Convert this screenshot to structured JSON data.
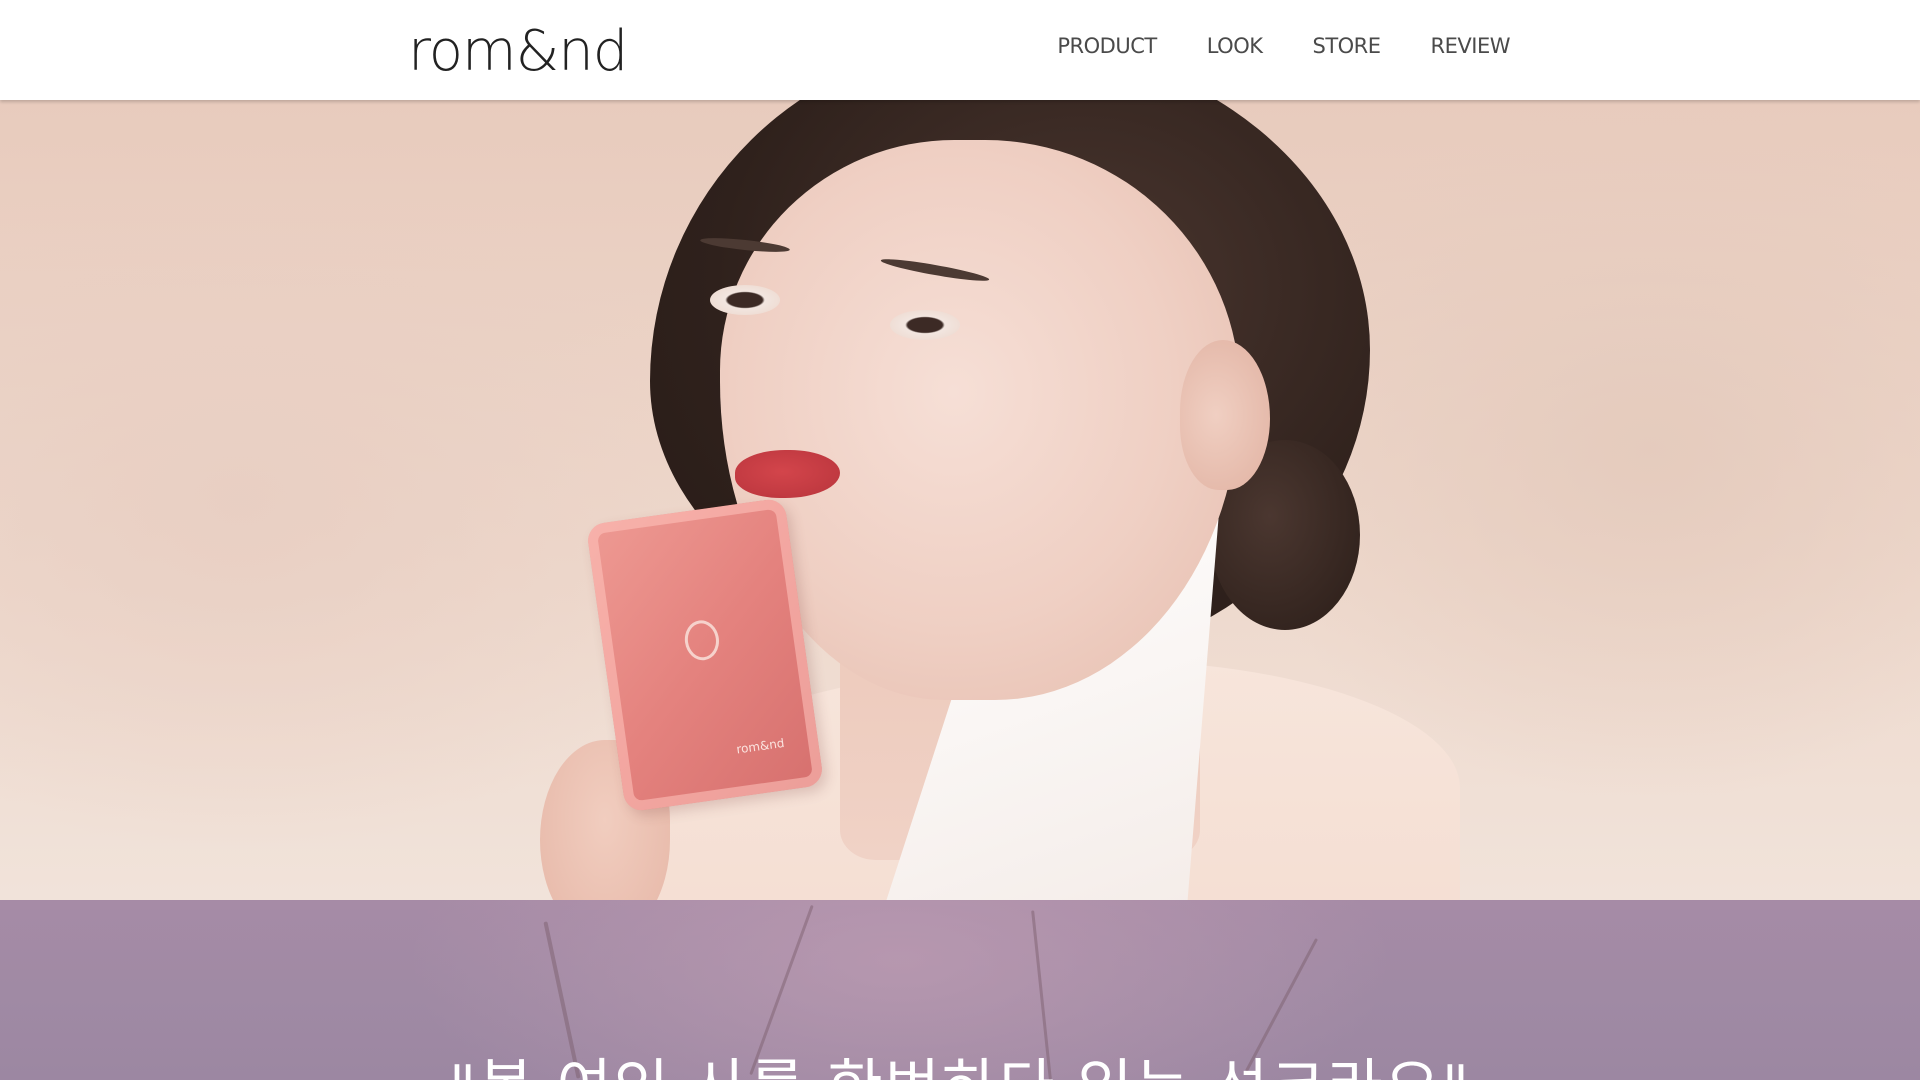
{
  "brand": {
    "logo_text": "rom&nd"
  },
  "nav": {
    "items": [
      {
        "label": "PRODUCT"
      },
      {
        "label": "LOOK"
      },
      {
        "label": "STORE"
      },
      {
        "label": "REVIEW"
      }
    ]
  },
  "hero": {
    "image": "model-with-blush-compact",
    "product_brand_text": "rom&nd"
  },
  "band": {
    "quote": "\"봄 여인 사를 한번하다 있는 선크라오\""
  },
  "colors": {
    "header_bg": "#ffffff",
    "nav_text": "#4a4a4a",
    "band_bg": "#a08aa4",
    "quote_text": "#ffffff"
  }
}
